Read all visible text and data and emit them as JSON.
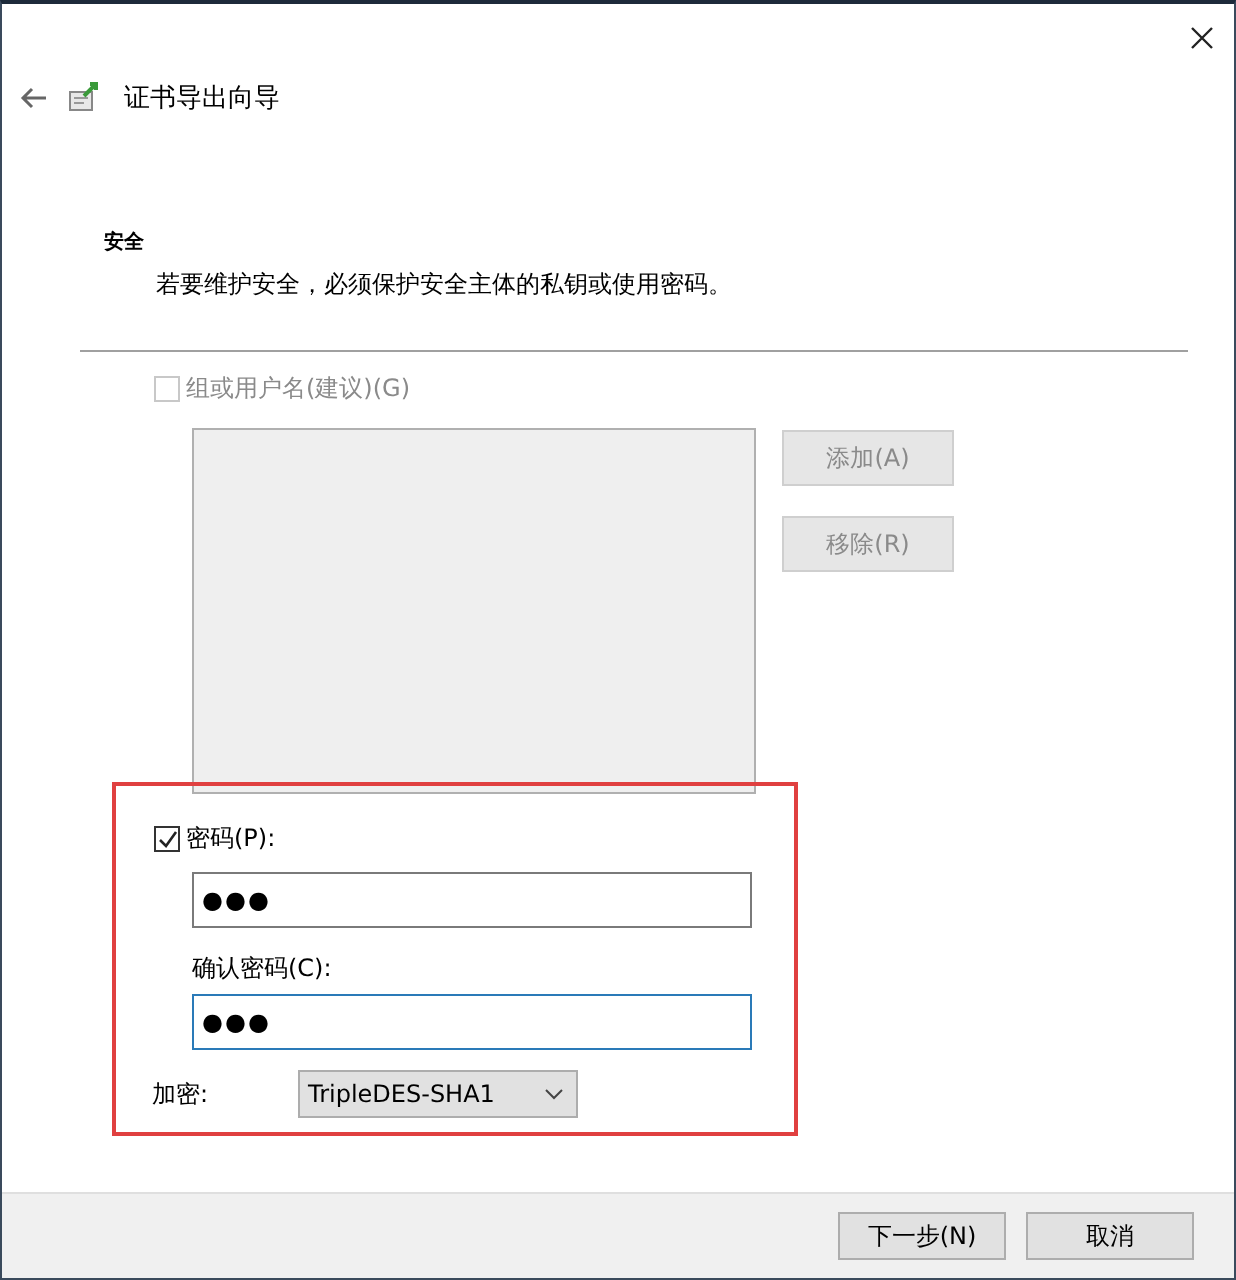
{
  "window": {
    "title": "证书导出向导"
  },
  "section": {
    "heading": "安全",
    "description": "若要维护安全，必须保护安全主体的私钥或使用密码。"
  },
  "group_option": {
    "label": "组或用户名(建议)(G)",
    "checked": false,
    "disabled": true
  },
  "group_buttons": [
    {
      "label": "添加(A)",
      "disabled": true
    },
    {
      "label": "移除(R)",
      "disabled": true
    }
  ],
  "password_option": {
    "label": "密码(P):",
    "checked": true,
    "disabled": false
  },
  "password_field": {
    "value": "●●●",
    "focused": false
  },
  "confirm_field": {
    "label": "确认密码(C):",
    "value": "●●●",
    "focused": true
  },
  "encryption": {
    "label": "加密:",
    "value": "TripleDES-SHA1"
  },
  "footer_buttons": [
    {
      "label": "下一步(N)"
    },
    {
      "label": "取消"
    }
  ]
}
